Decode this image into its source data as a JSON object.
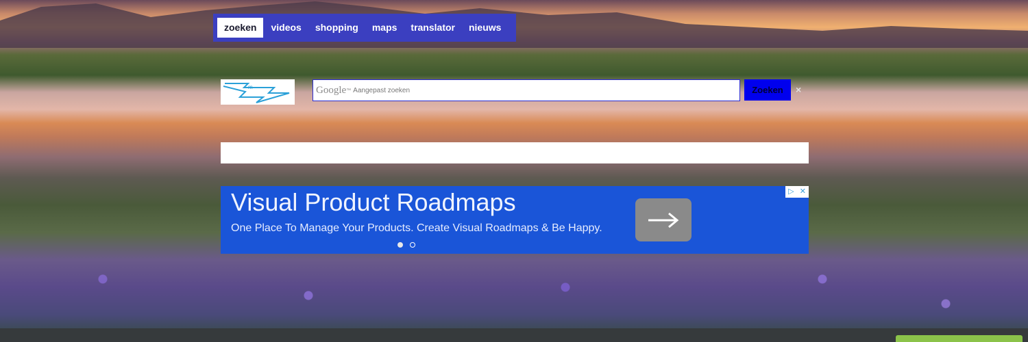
{
  "nav": {
    "items": [
      {
        "label": "zoeken",
        "active": true
      },
      {
        "label": "videos",
        "active": false
      },
      {
        "label": "shopping",
        "active": false
      },
      {
        "label": "maps",
        "active": false
      },
      {
        "label": "translator",
        "active": false
      },
      {
        "label": "nieuws",
        "active": false
      }
    ]
  },
  "search": {
    "google_label": "Google",
    "google_tm": "™",
    "placeholder": "Aangepast zoeken",
    "button_label": "Zoeken",
    "clear_symbol": "×"
  },
  "ad": {
    "title": "Visual Product Roadmaps",
    "description": "One Place To Manage Your Products. Create Visual Roadmaps & Be Happy.",
    "choices_icons": [
      "ad-choices-icon",
      "close-icon"
    ],
    "carousel": {
      "slides": 2,
      "active_index": 0
    }
  },
  "colors": {
    "nav_bg": "#3b3fc0",
    "search_button": "#0000ee",
    "ad_bg": "#1a55d8",
    "bottom_bar": "#363a3c",
    "green_button": "#8bc34a"
  }
}
